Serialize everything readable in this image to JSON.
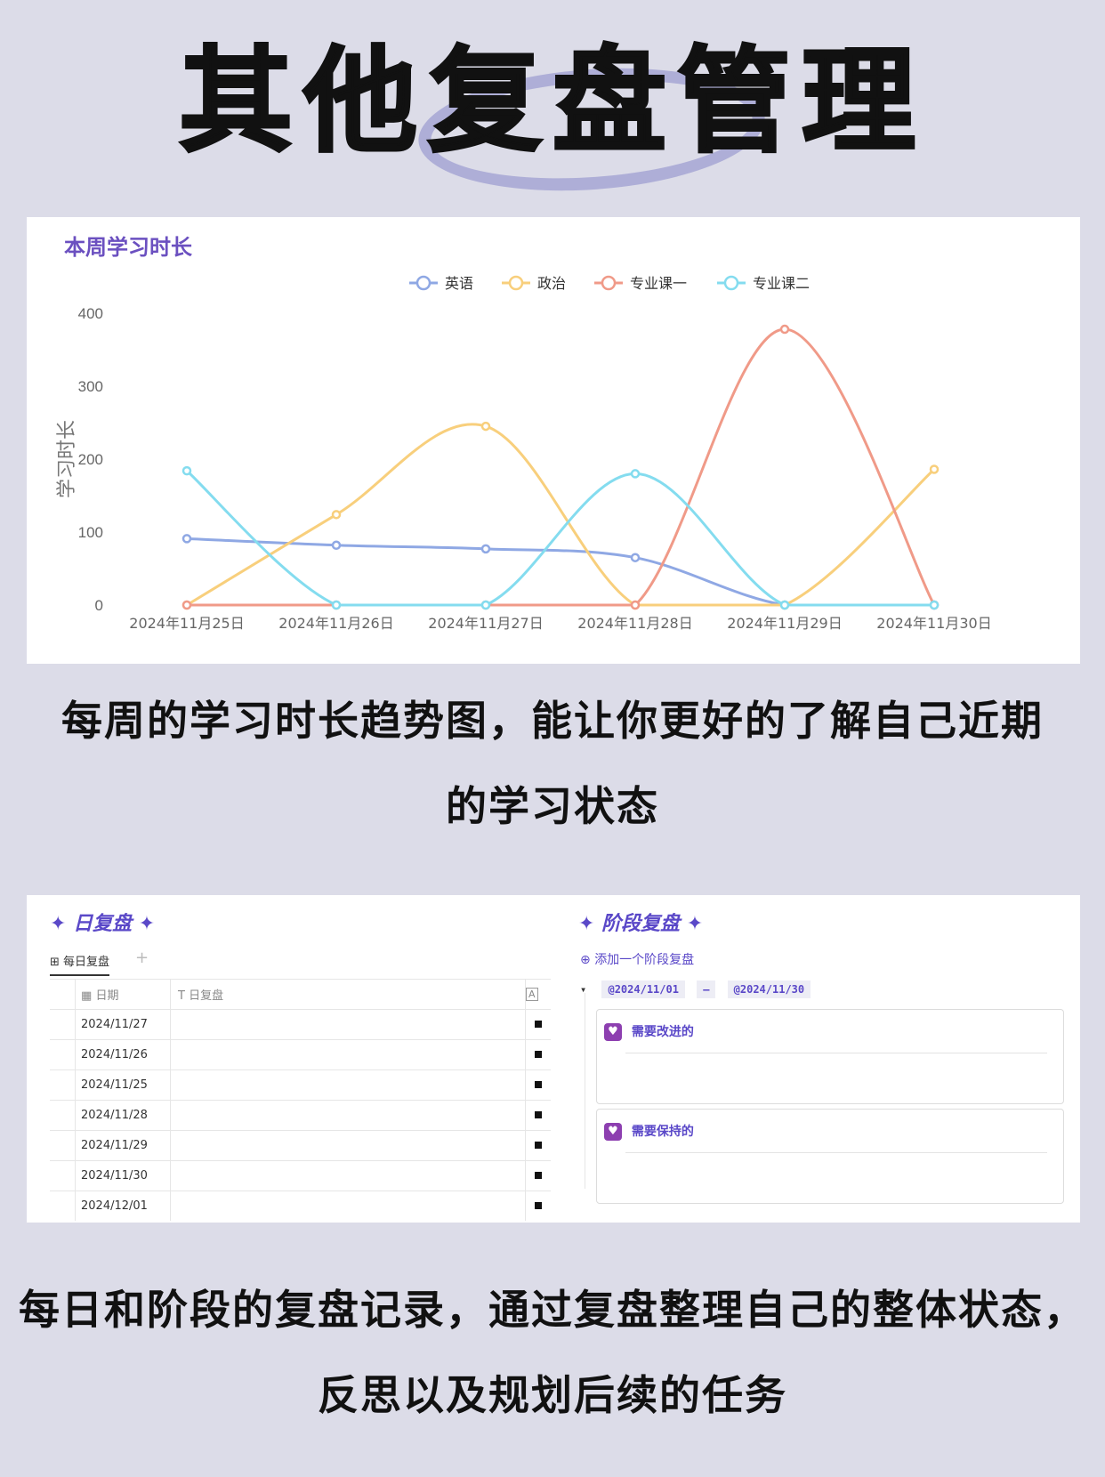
{
  "page": {
    "title": "其他复盘管理",
    "caption1": "每周的学习时长趋势图，能让你更好的了解自己近期的学习状态",
    "caption2": "每日和阶段的复盘记录，通过复盘整理自己的整体状态，反思以及规划后续的任务"
  },
  "chart_data": {
    "type": "line",
    "title": "本周学习时长",
    "ylabel": "学习时长",
    "xlabel": "",
    "categories": [
      "2024年11月25日",
      "2024年11月26日",
      "2024年11月27日",
      "2024年11月28日",
      "2024年11月29日",
      "2024年11月30日"
    ],
    "ylim": [
      0,
      400
    ],
    "yticks": [
      0,
      100,
      200,
      300,
      400
    ],
    "legend_position": "top-center",
    "smooth": true,
    "series": [
      {
        "name": "英语",
        "color": "#8fa8e4",
        "values": [
          91,
          82,
          77,
          65,
          0,
          0
        ]
      },
      {
        "name": "政治",
        "color": "#f8cf7c",
        "values": [
          0,
          124,
          245,
          0,
          0,
          186
        ]
      },
      {
        "name": "专业课一",
        "color": "#f09a88",
        "values": [
          0,
          0,
          0,
          0,
          378,
          0
        ]
      },
      {
        "name": "专业课二",
        "color": "#84dcef",
        "values": [
          184,
          0,
          0,
          180,
          0,
          0
        ]
      }
    ]
  },
  "daily": {
    "title": "✦ 日复盘 ✦",
    "tab": "每日复盘",
    "tab_icon": "table-icon",
    "add_tab": "+",
    "columns": {
      "date": "日期",
      "review": "日复盘"
    },
    "rows": [
      {
        "date": "2024/11/27"
      },
      {
        "date": "2024/11/26"
      },
      {
        "date": "2024/11/25"
      },
      {
        "date": "2024/11/28"
      },
      {
        "date": "2024/11/29"
      },
      {
        "date": "2024/11/30"
      },
      {
        "date": "2024/12/01"
      }
    ]
  },
  "stage": {
    "title": "✦ 阶段复盘 ✦",
    "add_label": "添加一个阶段复盘",
    "range_start": "@2024/11/01",
    "range_sep": "–",
    "range_end": "@2024/11/30",
    "card1_label": "需要改进的",
    "card2_label": "需要保持的"
  }
}
